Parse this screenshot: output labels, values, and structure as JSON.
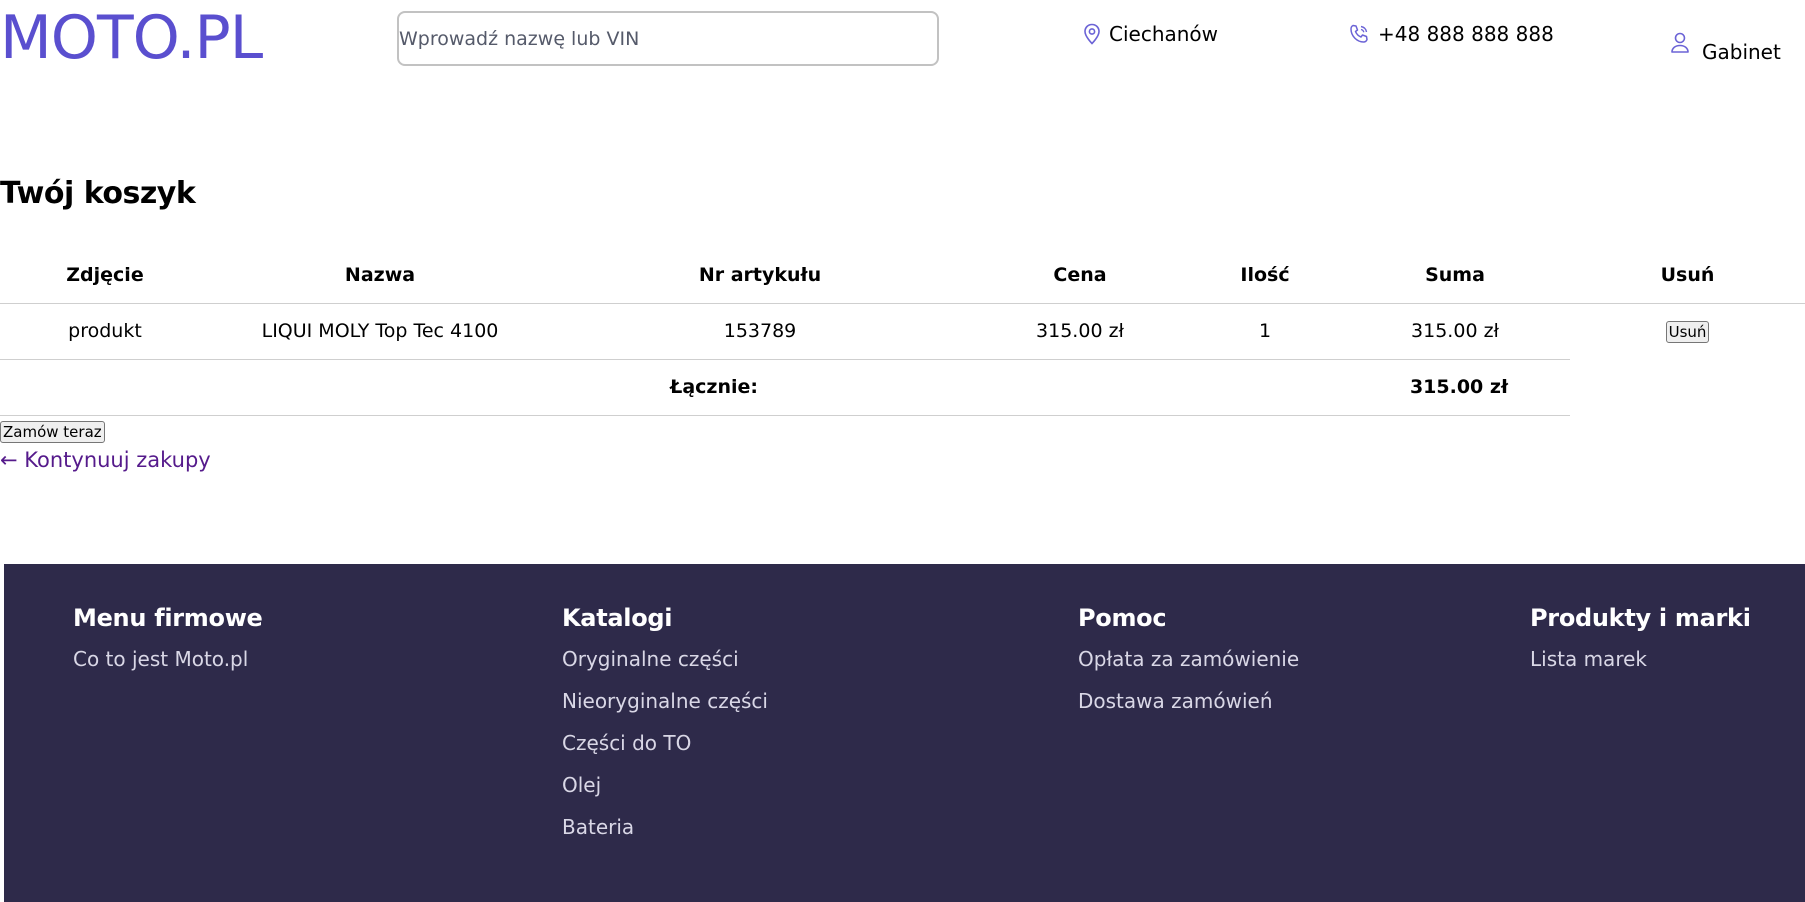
{
  "header": {
    "logo": "MOTO.PL",
    "search_placeholder": "Wprowadź nazwę lub VIN",
    "location": "Ciechanów",
    "phone": "+48 888 888 888",
    "cabinet": "Gabinet",
    "accent_color": "#5a4fcf"
  },
  "cart": {
    "title": "Twój koszyk",
    "columns": [
      "Zdjęcie",
      "Nazwa",
      "Nr artykułu",
      "Cena",
      "Ilość",
      "Suma",
      "Usuń"
    ],
    "items": [
      {
        "image_alt": "produkt",
        "name": "LIQUI MOLY Top Tec 4100",
        "article_no": "153789",
        "price": "315.00 zł",
        "quantity": "1",
        "sum": "315.00 zł",
        "remove_label": "Usuń"
      }
    ],
    "total_label": "Łącznie:",
    "total_value": "315.00 zł",
    "order_button": "Zamów teraz",
    "continue_link": "← Kontynuuj zakupy"
  },
  "footer": {
    "background": "#2e2a4a",
    "columns": [
      {
        "title": "Menu firmowe",
        "links": [
          "Co to jest Moto.pl"
        ]
      },
      {
        "title": "Katalogi",
        "links": [
          "Oryginalne części",
          "Nieoryginalne części",
          "Części do TO",
          "Olej",
          "Bateria"
        ]
      },
      {
        "title": "Pomoc",
        "links": [
          "Opłata za zamówienie",
          "Dostawa zamówień"
        ]
      },
      {
        "title": "Produkty i marki",
        "links": [
          "Lista marek"
        ]
      }
    ]
  }
}
